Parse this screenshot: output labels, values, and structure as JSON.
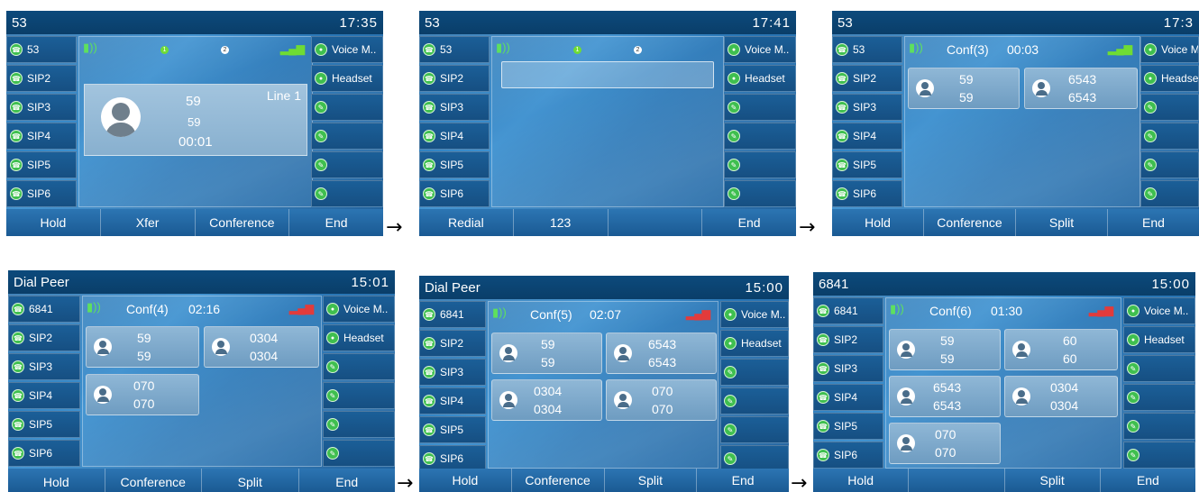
{
  "arrow_glyph": "→",
  "screens": [
    {
      "title": "53",
      "time": "17:35",
      "left_keys": [
        "53",
        "SIP2",
        "SIP3",
        "SIP4",
        "SIP5",
        "SIP6"
      ],
      "right_keys": [
        "Voice M..",
        "Headset",
        "",
        "",
        "",
        ""
      ],
      "call": {
        "number": "59",
        "name": "59",
        "duration": "00:01",
        "line": "Line 1"
      },
      "line_indicators": [
        "1",
        "2"
      ],
      "softkeys": [
        "Hold",
        "Xfer",
        "Conference",
        "End"
      ]
    },
    {
      "title": "53",
      "time": "17:41",
      "left_keys": [
        "53",
        "SIP2",
        "SIP3",
        "SIP4",
        "SIP5",
        "SIP6"
      ],
      "right_keys": [
        "Voice M..",
        "Headset",
        "",
        "",
        "",
        ""
      ],
      "line_indicators": [
        "1",
        "2"
      ],
      "softkeys": [
        "Redial",
        "123",
        "",
        "End"
      ]
    },
    {
      "title": "53",
      "time": "17:3",
      "left_keys": [
        "53",
        "SIP2",
        "SIP3",
        "SIP4",
        "SIP5",
        "SIP6"
      ],
      "right_keys": [
        "Voice M",
        "Headse",
        "",
        "",
        "",
        ""
      ],
      "conf_label": "Conf(3)",
      "conf_time": "00:03",
      "participants": [
        {
          "a": "59",
          "b": "59"
        },
        {
          "a": "6543",
          "b": "6543"
        }
      ],
      "softkeys": [
        "Hold",
        "Conference",
        "Split",
        "End"
      ]
    },
    {
      "title": "Dial Peer",
      "time": "15:01",
      "left_keys": [
        "6841",
        "SIP2",
        "SIP3",
        "SIP4",
        "SIP5",
        "SIP6"
      ],
      "right_keys": [
        "Voice M..",
        "Headset",
        "",
        "",
        "",
        ""
      ],
      "conf_label": "Conf(4)",
      "conf_time": "02:16",
      "participants": [
        {
          "a": "59",
          "b": "59"
        },
        {
          "a": "0304",
          "b": "0304"
        },
        {
          "a": "070",
          "b": "070"
        }
      ],
      "softkeys": [
        "Hold",
        "Conference",
        "Split",
        "End"
      ]
    },
    {
      "title": "Dial Peer",
      "time": "15:00",
      "left_keys": [
        "6841",
        "SIP2",
        "SIP3",
        "SIP4",
        "SIP5",
        "SIP6"
      ],
      "right_keys": [
        "Voice M..",
        "Headset",
        "",
        "",
        "",
        ""
      ],
      "conf_label": "Conf(5)",
      "conf_time": "02:07",
      "participants": [
        {
          "a": "59",
          "b": "59"
        },
        {
          "a": "6543",
          "b": "6543"
        },
        {
          "a": "0304",
          "b": "0304"
        },
        {
          "a": "070",
          "b": "070"
        }
      ],
      "softkeys": [
        "Hold",
        "Conference",
        "Split",
        "End"
      ]
    },
    {
      "title": "6841",
      "time": "15:00",
      "left_keys": [
        "6841",
        "SIP2",
        "SIP3",
        "SIP4",
        "SIP5",
        "SIP6"
      ],
      "right_keys": [
        "Voice M..",
        "Headset",
        "",
        "",
        "",
        ""
      ],
      "conf_label": "Conf(6)",
      "conf_time": "01:30",
      "participants": [
        {
          "a": "59",
          "b": "59"
        },
        {
          "a": "60",
          "b": "60"
        },
        {
          "a": "6543",
          "b": "6543"
        },
        {
          "a": "0304",
          "b": "0304"
        },
        {
          "a": "070",
          "b": "070"
        }
      ],
      "softkeys": [
        "Hold",
        "",
        "Split",
        "End"
      ]
    }
  ]
}
